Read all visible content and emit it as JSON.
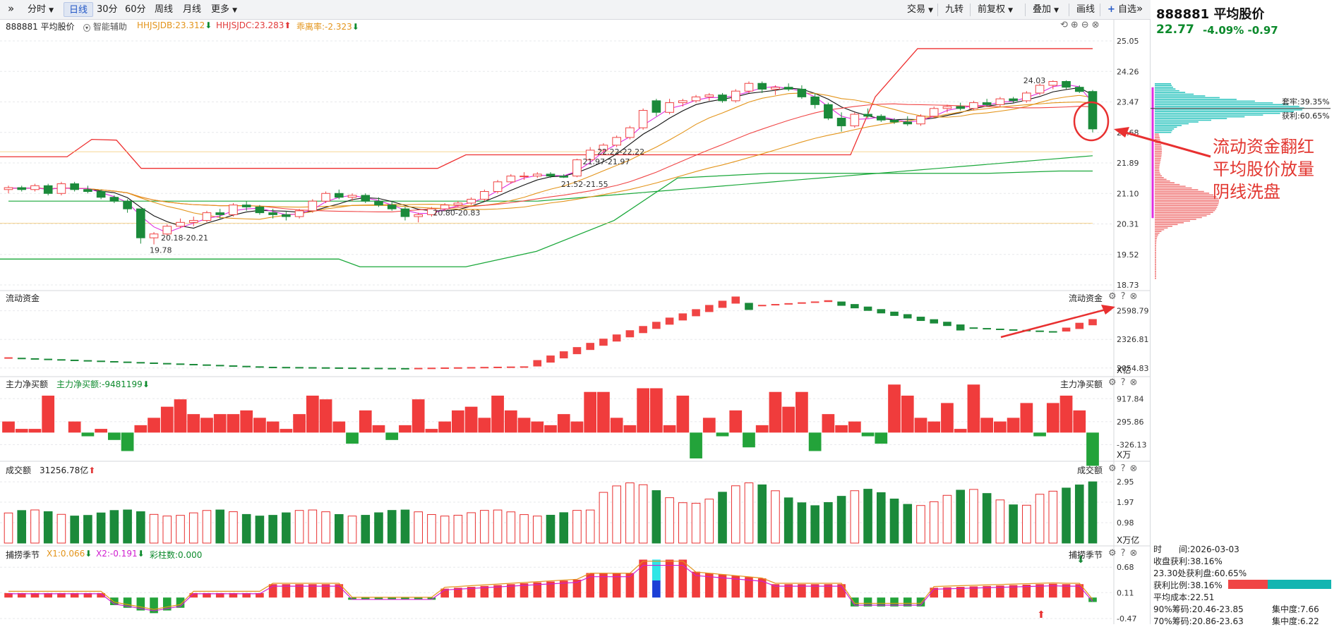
{
  "toolbar": {
    "collapse_icon": "double-chevron-right-icon",
    "items": [
      "分时",
      "日线",
      "30分",
      "60分",
      "周线",
      "月线",
      "更多"
    ],
    "right_items": [
      "交易",
      "九转",
      "前复权",
      "叠加",
      "画线",
      "自选"
    ],
    "add_icon": "plus-icon",
    "expand_icon": "double-chevron-right-icon"
  },
  "quote": {
    "code": "888881",
    "name": "平均股价",
    "price": "22.77",
    "change_pct": "-4.09%",
    "change": "-0.97"
  },
  "main": {
    "title": "888881 平均股价",
    "assist": "智能辅助",
    "ind1": "HHJSJDB:23.312",
    "ind2": "HHJSJDC:23.283",
    "ind3": "乖离率:-2.323",
    "price_axis": [
      "25.05",
      "24.26",
      "23.47",
      "22.68",
      "21.89",
      "21.10",
      "20.31",
      "19.52",
      "18.73"
    ],
    "labels": {
      "high": "24.03",
      "low": "19.78",
      "r1": "20.18-20.21",
      "r2": "20.80-20.83",
      "r3": "21.52-21.55",
      "r4": "21.97-21.97",
      "r5": "22.22-22.22"
    },
    "chip_profit": "获利:60.65%",
    "chip_trap": "套牢:39.35%"
  },
  "panels": {
    "p1": {
      "label": "流动资金",
      "right_label": "流动资金",
      "axis": [
        "2598.79",
        "2326.81",
        "2054.83"
      ],
      "unit": "X亿"
    },
    "p2": {
      "label": "主力净买额",
      "ind": "主力净买额:-9481199",
      "right_label": "主力净买额",
      "axis": [
        "917.84",
        "295.86",
        "-326.13"
      ],
      "unit": "X万"
    },
    "p3": {
      "label": "成交额",
      "value": "31256.78亿",
      "right_label": "成交额",
      "axis": [
        "2.95",
        "1.97",
        "0.98"
      ],
      "unit": "X万亿"
    },
    "p4": {
      "label": "捕捞季节",
      "x1": "X1:0.066",
      "x2": "X2:-0.191",
      "bars": "彩柱数:0.000",
      "right_label": "捕捞季节",
      "axis": [
        "0.68",
        "0.11",
        "-0.47"
      ]
    }
  },
  "annotation": {
    "lines": [
      "流动资金翻红",
      "平均股价放量",
      "阴线洗盘"
    ]
  },
  "stats": {
    "time": "时　　间:2026-03-03",
    "profit": "收盘获利:38.16%",
    "chip": "23.30处获利盘:60.65%",
    "ratio": "获利比例:38.16%",
    "cost": "平均成本:22.51",
    "c90": "90%筹码:20.46-23.85",
    "c90_conc": "集中度:7.66",
    "c70": "70%筹码:20.86-23.63",
    "c70_conc": "集中度:6.22"
  },
  "chart_data": {
    "type": "candlestick",
    "candles": [
      [
        21.2,
        21.3,
        21.1,
        21.25
      ],
      [
        21.25,
        21.3,
        21.15,
        21.2
      ],
      [
        21.2,
        21.35,
        21.15,
        21.3
      ],
      [
        21.3,
        21.35,
        21.05,
        21.1
      ],
      [
        21.1,
        21.4,
        21.05,
        21.35
      ],
      [
        21.35,
        21.4,
        21.15,
        21.2
      ],
      [
        21.2,
        21.3,
        21.1,
        21.15
      ],
      [
        21.15,
        21.2,
        20.95,
        21.0
      ],
      [
        21.0,
        21.05,
        20.85,
        20.9
      ],
      [
        20.9,
        20.95,
        20.6,
        20.7
      ],
      [
        20.7,
        20.7,
        19.8,
        19.95
      ],
      [
        19.95,
        20.1,
        19.78,
        20.05
      ],
      [
        20.05,
        20.3,
        20.0,
        20.25
      ],
      [
        20.25,
        20.45,
        20.2,
        20.35
      ],
      [
        20.35,
        20.5,
        20.25,
        20.4
      ],
      [
        20.4,
        20.65,
        20.35,
        20.6
      ],
      [
        20.6,
        20.7,
        20.45,
        20.55
      ],
      [
        20.55,
        20.85,
        20.5,
        20.8
      ],
      [
        20.8,
        20.9,
        20.65,
        20.75
      ],
      [
        20.75,
        20.8,
        20.55,
        20.6
      ],
      [
        20.6,
        20.7,
        20.45,
        20.55
      ],
      [
        20.55,
        20.65,
        20.4,
        20.5
      ],
      [
        20.5,
        20.7,
        20.45,
        20.65
      ],
      [
        20.65,
        20.95,
        20.6,
        20.9
      ],
      [
        20.9,
        21.15,
        20.85,
        21.1
      ],
      [
        21.1,
        21.2,
        20.95,
        21.0
      ],
      [
        21.0,
        21.1,
        20.9,
        21.05
      ],
      [
        21.05,
        21.1,
        20.85,
        20.9
      ],
      [
        20.9,
        21.0,
        20.75,
        20.8
      ],
      [
        20.8,
        20.9,
        20.65,
        20.7
      ],
      [
        20.7,
        20.75,
        20.4,
        20.5
      ],
      [
        20.5,
        20.6,
        20.35,
        20.55
      ],
      [
        20.55,
        20.75,
        20.5,
        20.7
      ],
      [
        20.7,
        20.85,
        20.65,
        20.8
      ],
      [
        20.8,
        20.9,
        20.75,
        20.85
      ],
      [
        20.85,
        21.0,
        20.8,
        20.95
      ],
      [
        20.95,
        21.2,
        20.9,
        21.15
      ],
      [
        21.15,
        21.45,
        21.1,
        21.4
      ],
      [
        21.4,
        21.6,
        21.35,
        21.55
      ],
      [
        21.55,
        21.65,
        21.45,
        21.55
      ],
      [
        21.55,
        21.65,
        21.5,
        21.6
      ],
      [
        21.6,
        21.65,
        21.5,
        21.55
      ],
      [
        21.55,
        21.6,
        21.5,
        21.52
      ],
      [
        21.55,
        22.0,
        21.52,
        21.97
      ],
      [
        21.97,
        22.3,
        21.95,
        22.22
      ],
      [
        22.22,
        22.4,
        22.15,
        22.35
      ],
      [
        22.35,
        22.6,
        22.3,
        22.55
      ],
      [
        22.55,
        22.85,
        22.5,
        22.8
      ],
      [
        22.8,
        23.3,
        22.75,
        23.25
      ],
      [
        23.5,
        23.55,
        23.1,
        23.2
      ],
      [
        23.2,
        23.55,
        23.15,
        23.45
      ],
      [
        23.45,
        23.55,
        23.35,
        23.5
      ],
      [
        23.5,
        23.65,
        23.45,
        23.6
      ],
      [
        23.6,
        23.7,
        23.5,
        23.65
      ],
      [
        23.65,
        23.7,
        23.45,
        23.5
      ],
      [
        23.5,
        23.8,
        23.45,
        23.75
      ],
      [
        23.75,
        24.0,
        23.7,
        23.95
      ],
      [
        23.95,
        24.0,
        23.7,
        23.8
      ],
      [
        23.8,
        23.9,
        23.65,
        23.85
      ],
      [
        23.85,
        23.95,
        23.75,
        23.8
      ],
      [
        23.8,
        23.9,
        23.55,
        23.6
      ],
      [
        23.6,
        23.7,
        23.3,
        23.4
      ],
      [
        23.4,
        23.45,
        23.0,
        23.05
      ],
      [
        23.05,
        23.2,
        22.7,
        22.85
      ],
      [
        22.85,
        23.2,
        22.8,
        23.15
      ],
      [
        23.15,
        23.3,
        23.05,
        23.1
      ],
      [
        23.1,
        23.15,
        22.95,
        23.0
      ],
      [
        23.0,
        23.05,
        22.9,
        22.95
      ],
      [
        22.95,
        23.1,
        22.85,
        22.9
      ],
      [
        22.9,
        23.15,
        22.85,
        23.1
      ],
      [
        23.1,
        23.35,
        23.05,
        23.3
      ],
      [
        23.3,
        23.4,
        23.2,
        23.35
      ],
      [
        23.35,
        23.45,
        23.25,
        23.3
      ],
      [
        23.3,
        23.5,
        23.25,
        23.45
      ],
      [
        23.45,
        23.55,
        23.35,
        23.4
      ],
      [
        23.4,
        23.6,
        23.35,
        23.55
      ],
      [
        23.55,
        23.6,
        23.45,
        23.5
      ],
      [
        23.5,
        23.75,
        23.45,
        23.7
      ],
      [
        23.7,
        23.95,
        23.65,
        23.9
      ],
      [
        23.9,
        24.03,
        23.8,
        24.0
      ],
      [
        24.0,
        24.03,
        23.8,
        23.85
      ],
      [
        23.85,
        23.9,
        23.7,
        23.74
      ],
      [
        23.74,
        23.78,
        22.68,
        22.77
      ]
    ]
  }
}
